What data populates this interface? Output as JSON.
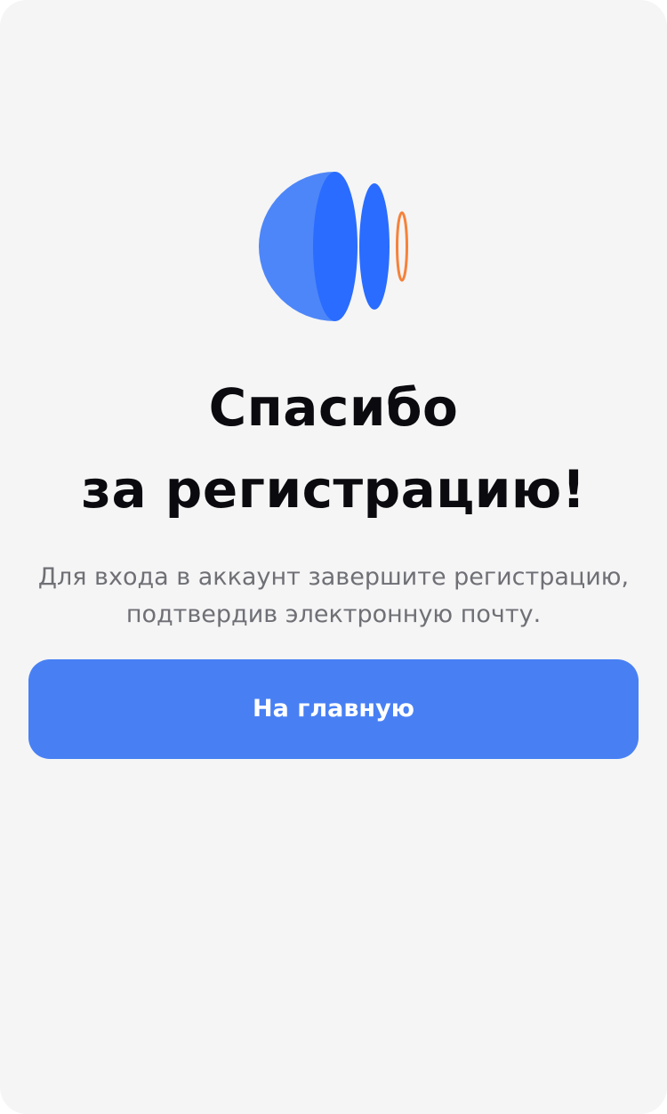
{
  "logo": {
    "icon": "brand-logo-icon",
    "colors": {
      "light_blue": "#4d86f8",
      "blue": "#2a6cff",
      "orange": "#f5823b"
    }
  },
  "heading": {
    "line1": "Спасибо",
    "line2": "за регистрацию!"
  },
  "message": {
    "line1": "Для входа в аккаунт завершите регистрацию,",
    "line2": "подтвердив электронную почту."
  },
  "actions": {
    "home_label": "На главную"
  },
  "colors": {
    "background": "#f5f5f6",
    "accent": "#4880f4",
    "heading_text": "#0b0b0f",
    "body_text": "#6f7075"
  }
}
